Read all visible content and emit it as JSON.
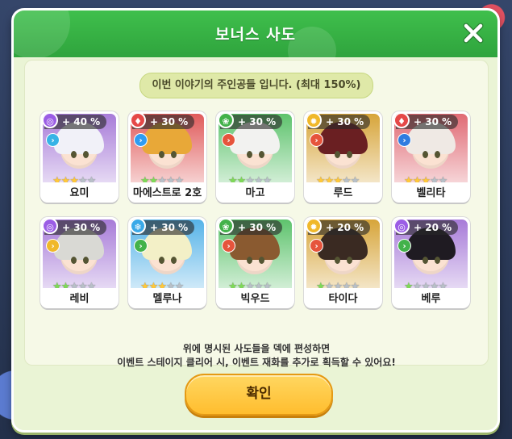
{
  "dialog": {
    "title": "보너스 사도",
    "banner": "이번 이야기의 주인공들 입니다. (최대 150%)",
    "description_line1": "위에 명시된 사도들을 덱에 편성하면",
    "description_line2": "이벤트 스테이지 클리어 시, 이벤트 재화를 추가로 획득할 수 있어요!",
    "confirm_label": "확인"
  },
  "characters": [
    {
      "name": "요미",
      "bonus": "+ 40 %",
      "stars": 3,
      "element": "swirl-icon",
      "element_color": "#9b5de5",
      "role": "chevron-icon",
      "role_color": "#36b3e6",
      "frame": "#a77bd8",
      "hair": "#f1f1f8"
    },
    {
      "name": "마에스트로 2호",
      "bonus": "+ 30 %",
      "stars": 2,
      "element": "flame-icon",
      "element_color": "#e54848",
      "role": "chevron-icon",
      "role_color": "#2f9cf1",
      "frame": "#e05b5b",
      "hair": "#e8a838"
    },
    {
      "name": "마고",
      "bonus": "+ 30 %",
      "stars": 2,
      "element": "leaf-icon",
      "element_color": "#43b24a",
      "role": "chevron-icon",
      "role_color": "#e6543c",
      "frame": "#5ec36d",
      "hair": "#f2f2f0"
    },
    {
      "name": "루드",
      "bonus": "+ 30 %",
      "stars": 3,
      "element": "sun-icon",
      "element_color": "#f0b82a",
      "role": "chevron-icon",
      "role_color": "#e6543c",
      "frame": "#d7a53a",
      "hair": "#6a1f22"
    },
    {
      "name": "벨리타",
      "bonus": "+ 30 %",
      "stars": 3,
      "element": "flame-icon",
      "element_color": "#e54848",
      "role": "chevron-icon",
      "role_color": "#2f7ce0",
      "frame": "#e06a74",
      "hair": "#efe9e4"
    },
    {
      "name": "레비",
      "bonus": "+ 30 %",
      "stars": 2,
      "element": "swirl-icon",
      "element_color": "#9b5de5",
      "role": "chevron-icon",
      "role_color": "#f0b82a",
      "frame": "#a77bd8",
      "hair": "#d9d9d4"
    },
    {
      "name": "멜루나",
      "bonus": "+ 30 %",
      "stars": 3,
      "element": "snowflake-icon",
      "element_color": "#3aa9e8",
      "role": "chevron-icon",
      "role_color": "#43b24a",
      "frame": "#56b3e8",
      "hair": "#f3f0c7"
    },
    {
      "name": "빅우드",
      "bonus": "+ 30 %",
      "stars": 2,
      "element": "leaf-icon",
      "element_color": "#43b24a",
      "role": "chevron-icon",
      "role_color": "#e6543c",
      "frame": "#5ec36d",
      "hair": "#8a5a30"
    },
    {
      "name": "타이다",
      "bonus": "+ 20 %",
      "stars": 1,
      "element": "sun-icon",
      "element_color": "#f0b82a",
      "role": "chevron-icon",
      "role_color": "#e6543c",
      "frame": "#d7a53a",
      "hair": "#3a2a22"
    },
    {
      "name": "베루",
      "bonus": "+ 20 %",
      "stars": 1,
      "element": "swirl-icon",
      "element_color": "#9b5de5",
      "role": "chevron-icon",
      "role_color": "#43b24a",
      "frame": "#a77bd8",
      "hair": "#1f1b22"
    }
  ]
}
